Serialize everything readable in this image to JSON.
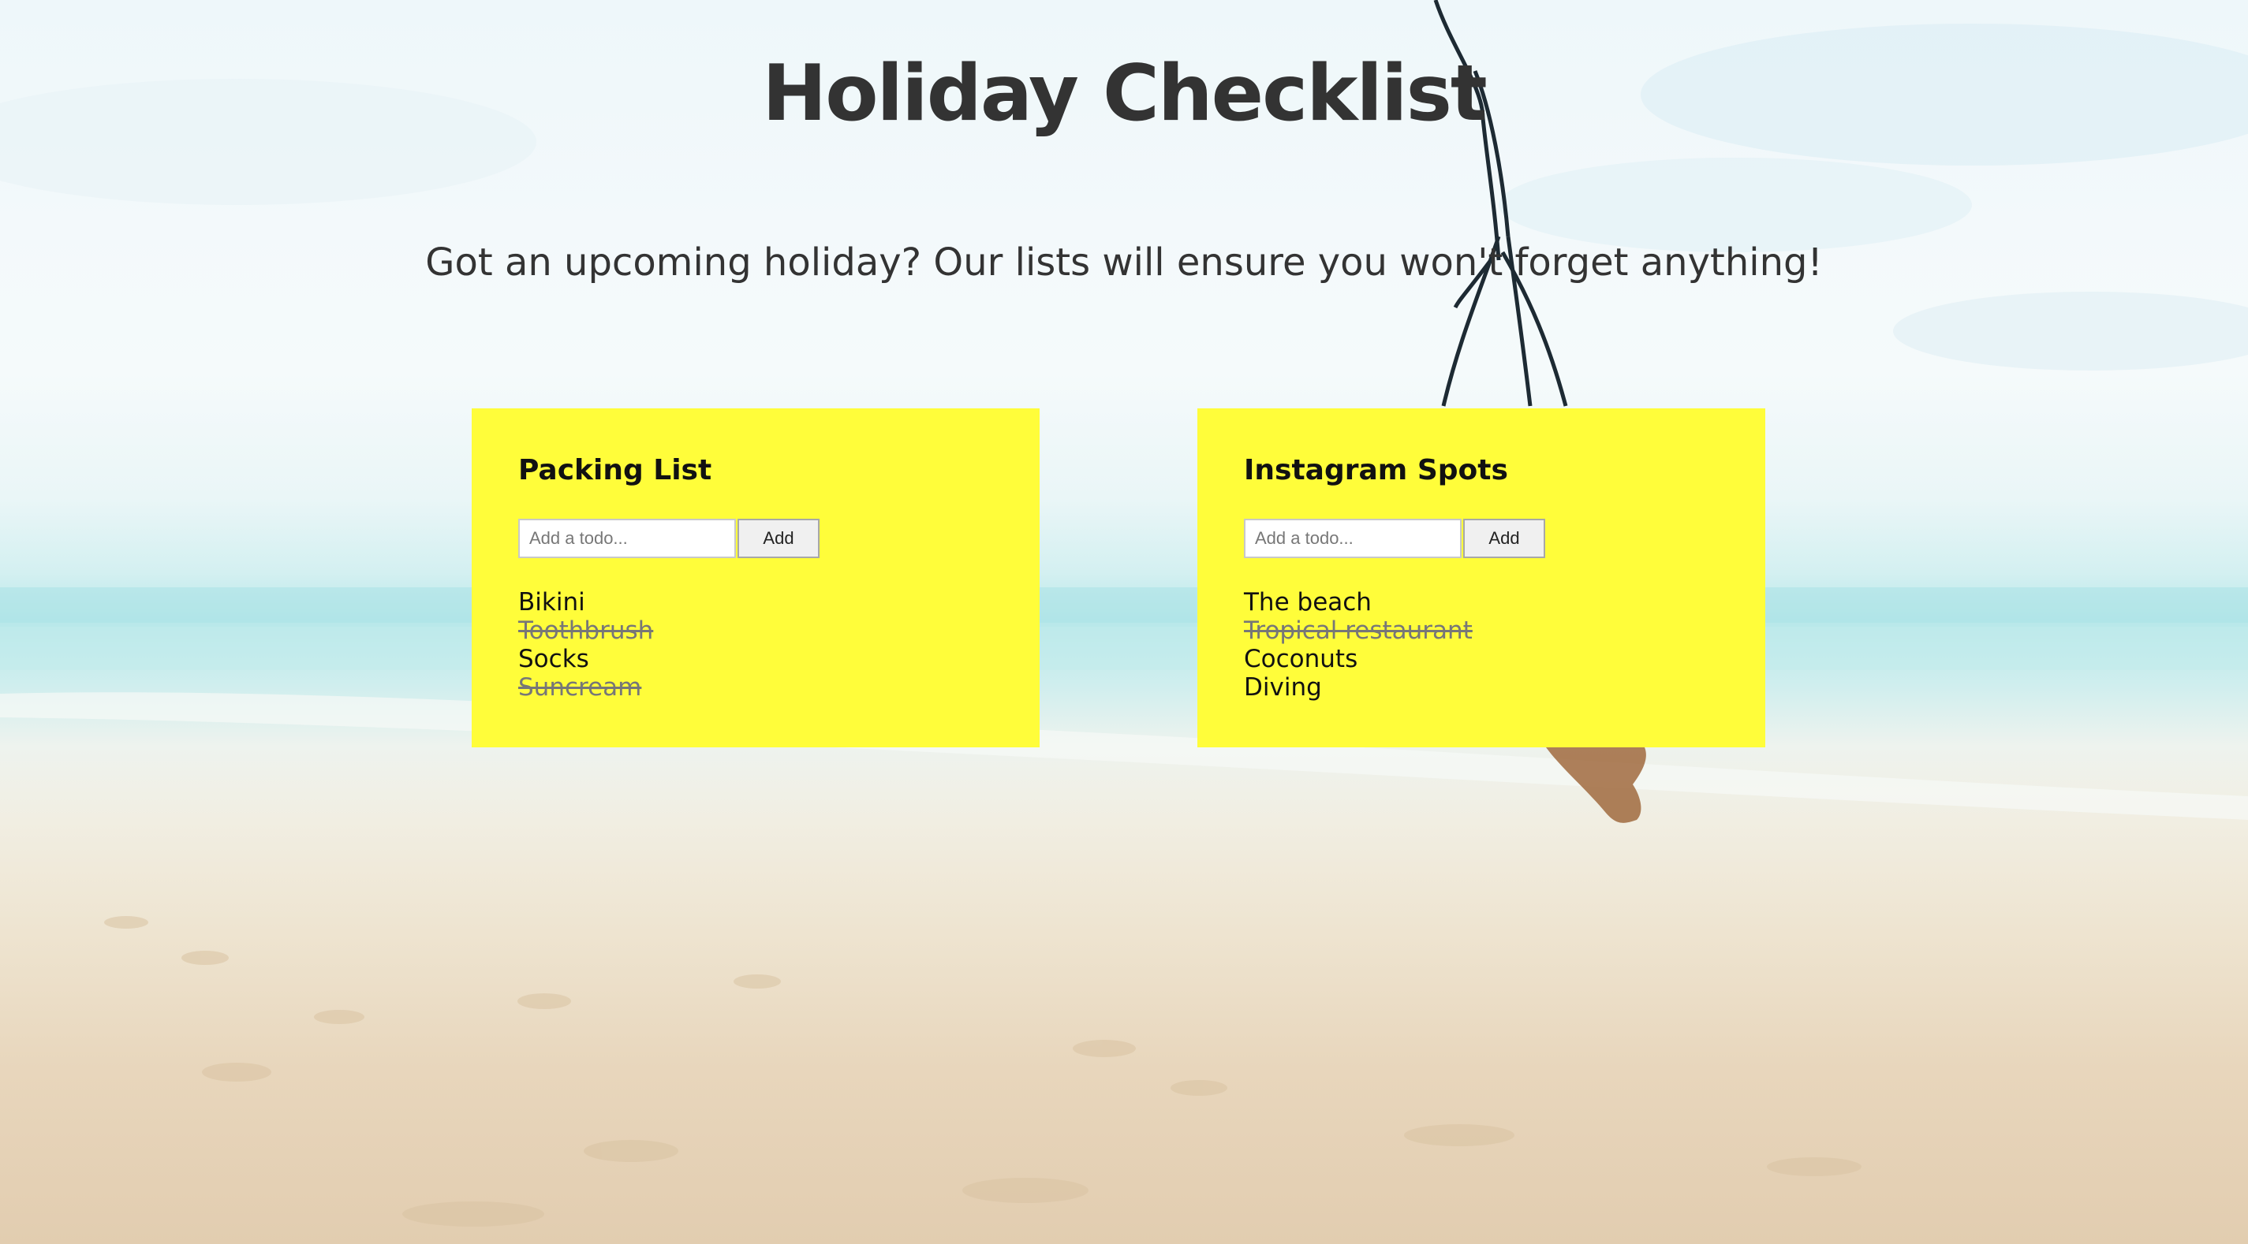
{
  "header": {
    "title": "Holiday Checklist",
    "subtitle": "Got an upcoming holiday? Our lists will ensure you won't forget anything!"
  },
  "lists": [
    {
      "title": "Packing List",
      "input_placeholder": "Add a todo...",
      "input_value": "",
      "add_label": "Add",
      "items": [
        {
          "label": "Bikini",
          "done": false
        },
        {
          "label": "Toothbrush",
          "done": true
        },
        {
          "label": "Socks",
          "done": false
        },
        {
          "label": "Suncream",
          "done": true
        }
      ]
    },
    {
      "title": "Instagram Spots",
      "input_placeholder": "Add a todo...",
      "input_value": "",
      "add_label": "Add",
      "items": [
        {
          "label": "The beach",
          "done": false
        },
        {
          "label": "Tropical restaurant",
          "done": true
        },
        {
          "label": "Coconuts",
          "done": false
        },
        {
          "label": "Diving",
          "done": false
        }
      ]
    }
  ],
  "colors": {
    "card_background": "#fffd3a",
    "heading_text": "#333333",
    "done_text": "#777777"
  }
}
